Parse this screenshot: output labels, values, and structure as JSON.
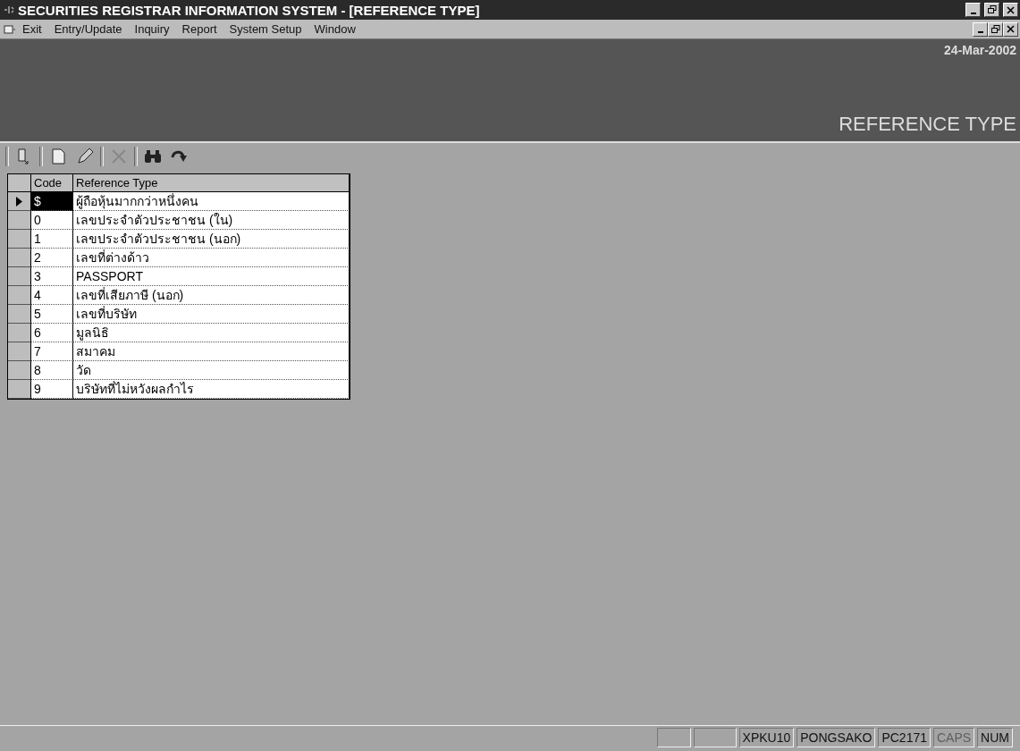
{
  "window": {
    "title": "SECURITIES REGISTRAR INFORMATION SYSTEM - [REFERENCE TYPE]"
  },
  "menu": [
    "Exit",
    "Entry/Update",
    "Inquiry",
    "Report",
    "System Setup",
    "Window"
  ],
  "banner": {
    "date": "24-Mar-2002",
    "title": "REFERENCE TYPE"
  },
  "toolbar": [
    {
      "kind": "exit",
      "disabled": false
    },
    {
      "kind": "new",
      "disabled": false
    },
    {
      "kind": "edit",
      "disabled": false
    },
    {
      "kind": "delete",
      "disabled": true
    },
    {
      "kind": "find",
      "disabled": false
    },
    {
      "kind": "next",
      "disabled": false
    }
  ],
  "table": {
    "columns": [
      "Code",
      "Reference Type"
    ],
    "rows": [
      {
        "code": "$",
        "type": "ผู้ถือหุ้นมากกว่าหนึ่งคน",
        "selected": true
      },
      {
        "code": "0",
        "type": "เลขประจำตัวประชาชน (ใน)",
        "selected": false
      },
      {
        "code": "1",
        "type": "เลขประจำตัวประชาชน (นอก)",
        "selected": false
      },
      {
        "code": "2",
        "type": "เลขที่ต่างด้าว",
        "selected": false
      },
      {
        "code": "3",
        "type": "PASSPORT",
        "selected": false
      },
      {
        "code": "4",
        "type": "เลขที่เสียภาษี (นอก)",
        "selected": false
      },
      {
        "code": "5",
        "type": "เลขที่บริษัท",
        "selected": false
      },
      {
        "code": "6",
        "type": "มูลนิธิ",
        "selected": false
      },
      {
        "code": "7",
        "type": "สมาคม",
        "selected": false
      },
      {
        "code": "8",
        "type": "วัด",
        "selected": false
      },
      {
        "code": "9",
        "type": "บริษัทที่ไม่หวังผลกำไร",
        "selected": false
      }
    ]
  },
  "status_bar": [
    {
      "text": "XPKU10",
      "on": true
    },
    {
      "text": "PONGSAKO",
      "on": true
    },
    {
      "text": "PC2171",
      "on": true
    },
    {
      "text": "CAPS",
      "on": false
    },
    {
      "text": "NUM",
      "on": true
    }
  ]
}
